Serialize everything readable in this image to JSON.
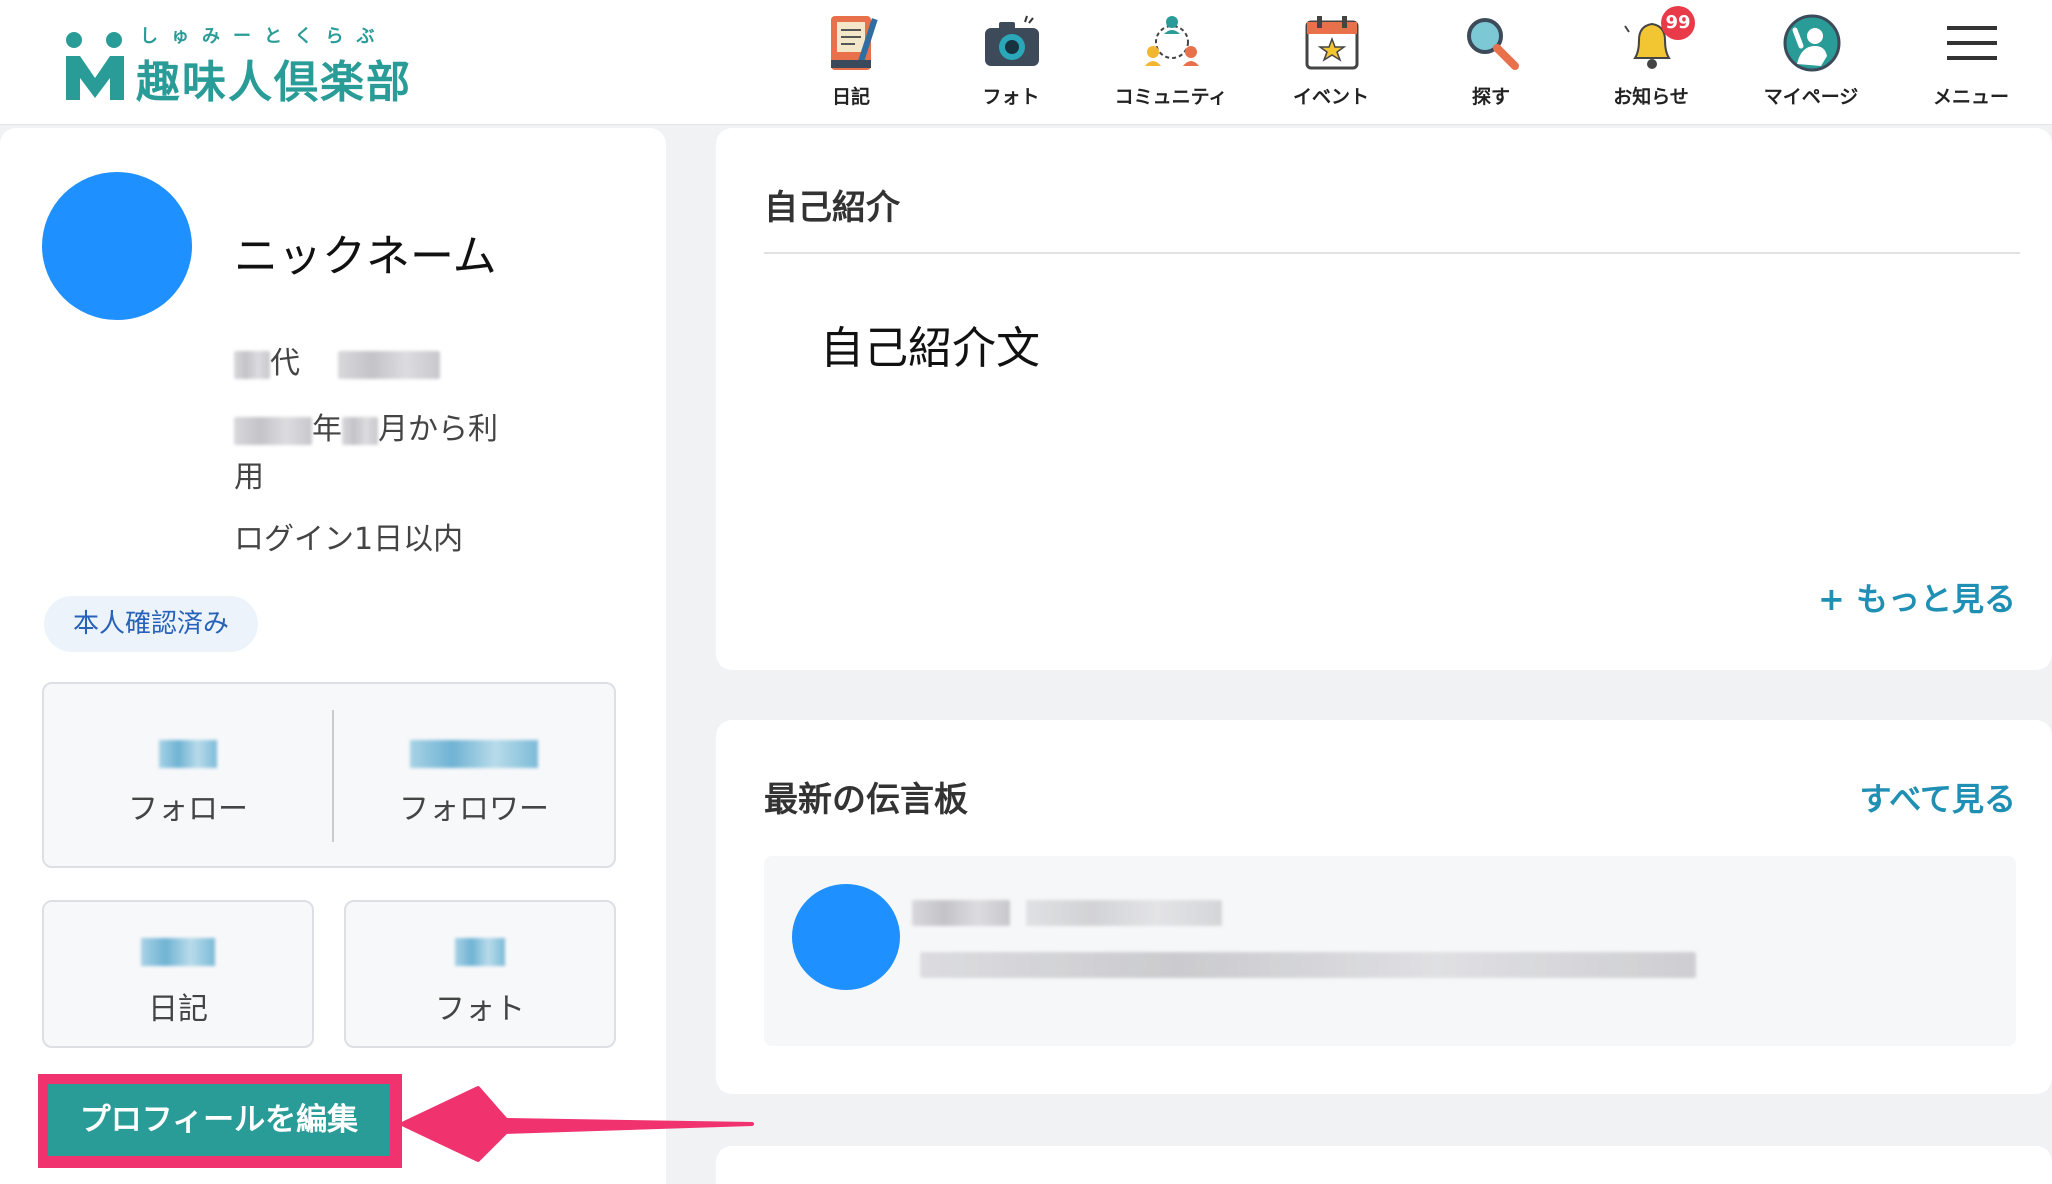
{
  "brand": {
    "kana": "しゅみーとくらぶ",
    "name": "趣味人倶楽部"
  },
  "nav": {
    "diary": "日記",
    "photo": "フォト",
    "community": "コミュニティ",
    "event": "イベント",
    "search": "探す",
    "notifications": "お知らせ",
    "notifications_badge": "99",
    "mypage": "マイページ",
    "menu": "メニュー"
  },
  "profile": {
    "nickname": "ニックネーム",
    "age_suffix": "代",
    "since_year_suffix": "年",
    "since_month_suffix": "月から利",
    "since_wrap": "用",
    "last_login": "ログイン1日以内",
    "verified": "本人確認済み",
    "stats": {
      "follow_label": "フォロー",
      "follower_label": "フォロワー",
      "diary_label": "日記",
      "photo_label": "フォト"
    },
    "edit_button": "プロフィールを編集"
  },
  "intro": {
    "title": "自己紹介",
    "text": "自己紹介文",
    "more": "+ もっと見る"
  },
  "board": {
    "title": "最新の伝言板",
    "see_all": "すべて見る"
  },
  "colors": {
    "brand": "#2a9c98",
    "link": "#1f8fb4",
    "avatar": "#1e90ff",
    "highlight": "#f0326f",
    "badge": "#e83a48"
  }
}
